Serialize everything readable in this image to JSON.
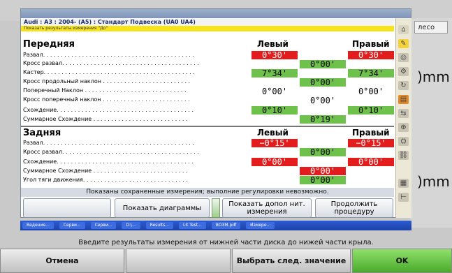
{
  "dialog": {
    "title": "",
    "vehicle": "Audi : A3 : 2004- (A5) : Стандарт Подвеска (UA0 UA4)",
    "notice": "Показать результаты измерения \"До\"",
    "front": {
      "heading": "Передняя",
      "left_label": "Левый",
      "right_label": "Правый",
      "rows": [
        {
          "label": "Развал. . . . . . . . . . . . . . . . . . . . . . . . . . . . . . . . . . . . . . . . . . ."
        },
        {
          "label": "Кросс развал. . . . . . . . . . . . . . . . . . . . . . . . . . . . . . . . . . . . . . ."
        },
        {
          "label": "Кастер. . . . . . . . . . . . . . . . . . . . . . . . . . . . . . . . . . . . . . . . . . ."
        },
        {
          "label": "Кросс продольный наклон . . . . . . . . . . . . . . . . . . . . . . . . ."
        },
        {
          "label": "Поперечный Наклон . . . . . . . . . . . . . . . . . . . . . . . . . . . . ."
        },
        {
          "label": "Кросс поперечный наклон . . . . . . . . . . . . . . . . . . . . . . . . ."
        },
        {
          "label": "Схождение. . . . . . . . . . . . . . . . . . . . . . . . . . . . . . . . . . . . . . ."
        },
        {
          "label": "Суммарное Схождение . . . . . . . . . . . . . . . . . . . . . . . . . . ."
        }
      ],
      "camber_left": "0°30'",
      "camber_right": "0°30'",
      "cross_camber": "0°00'",
      "caster_left": "7°34'",
      "caster_right": "7°34'",
      "cross_caster": "0°00'",
      "sai_left": "0°00'",
      "sai_right": "0°00'",
      "cross_sai": "0°00'",
      "toe_left": "0°10'",
      "toe_right": "0°10'",
      "total_toe": "0°19'"
    },
    "rear": {
      "heading": "Задняя",
      "left_label": "Левый",
      "right_label": "Правый",
      "rows": [
        {
          "label": "Развал. . . . . . . . . . . . . . . . . . . . . . . . . . . . . . . . . . . . . . . . . . ."
        },
        {
          "label": "Кросс развал. . . . . . . . . . . . . . . . . . . . . . . . . . . . . . . . . . . . . . ."
        },
        {
          "label": "Схождение. . . . . . . . . . . . . . . . . . . . . . . . . . . . . . . . . . . . . . ."
        },
        {
          "label": "Суммарное Схождение . . . . . . . . . . . . . . . . . . . . . . . . . . ."
        },
        {
          "label": "Угол тяги движения. . . . . . . . . . . . . . . . . . . . . . . . . . . . . ."
        }
      ],
      "camber_left": "−0°15'",
      "camber_right": "−0°15'",
      "cross_camber": "0°00'",
      "toe_left": "0°00'",
      "toe_right": "0°00'",
      "total_toe": "0°00'",
      "thrust_angle": "0°00'"
    },
    "status": "Показаны сохраненные измерения; выполние регулировки невозможно.",
    "buttons": {
      "show_charts": "Показать диаграммы",
      "show_extra": "Показать допол нит. измерения",
      "continue": "Продолжить процедуру"
    },
    "colors": {
      "red": "#e31d1d",
      "green": "#6ec14a",
      "yellow": "#f7e31a"
    }
  },
  "background": {
    "tab_label": "лесо",
    "unit1": ")mm",
    "unit2": ")mm"
  },
  "taskbar": {
    "items": [
      "Ведение...",
      "Серви...",
      "Серви...",
      "D:\\...",
      "Results...",
      "Lit Test...",
      "ВОЗМ.pdf",
      "Измере..."
    ]
  },
  "bottom": {
    "hint": "Введите результаты измерения от нижней части диска до нижей части крыла.",
    "cancel": "Отмена",
    "select_next": "Выбрать след. значение",
    "ok": "OK"
  }
}
